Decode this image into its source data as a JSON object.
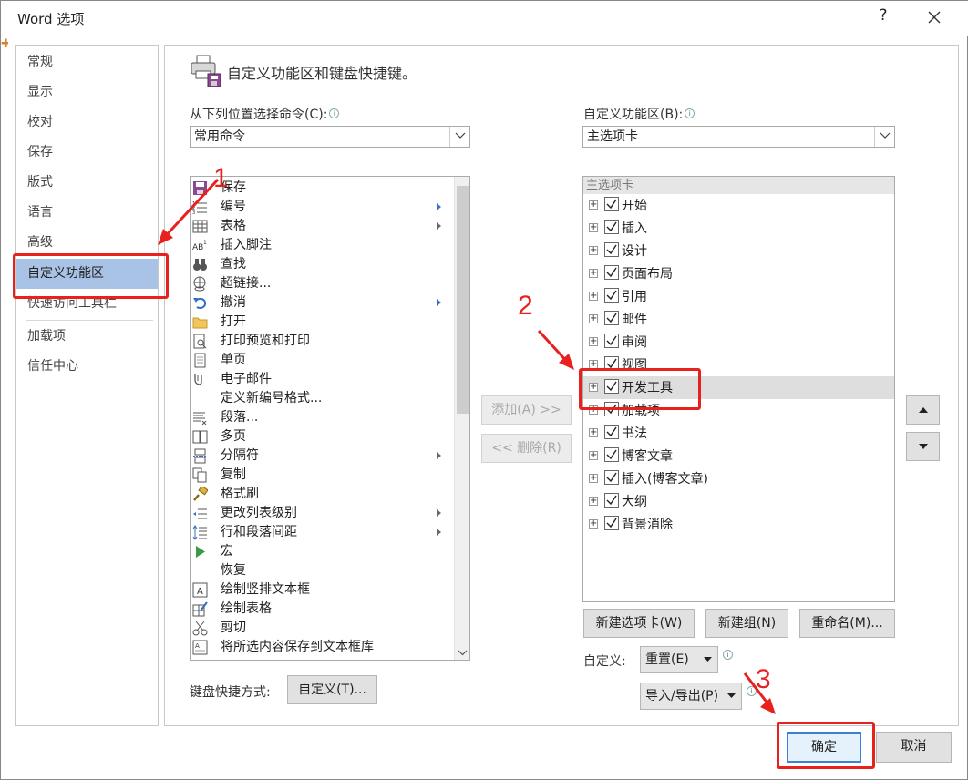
{
  "window": {
    "title": "Word 选项",
    "help": "?"
  },
  "nav": {
    "items": [
      {
        "label": "常规"
      },
      {
        "label": "显示"
      },
      {
        "label": "校对"
      },
      {
        "label": "保存"
      },
      {
        "label": "版式"
      },
      {
        "label": "语言"
      },
      {
        "label": "高级"
      },
      {
        "label": "自定义功能区",
        "selected": true
      },
      {
        "label": "快速访问工具栏"
      },
      {
        "label": "加载项"
      },
      {
        "label": "信任中心"
      }
    ]
  },
  "header": {
    "title": "自定义功能区和键盘快捷键。"
  },
  "left_panel": {
    "choose_label": "从下列位置选择命令(C):",
    "choose_value": "常用命令",
    "commands": [
      {
        "label": "保存",
        "icon": "save-icon"
      },
      {
        "label": "编号",
        "icon": "numbering-icon",
        "submenu": "blue"
      },
      {
        "label": "表格",
        "icon": "table-icon",
        "submenu": "gray"
      },
      {
        "label": "插入脚注",
        "icon": "footnote-icon"
      },
      {
        "label": "查找",
        "icon": "binoculars-icon"
      },
      {
        "label": "超链接...",
        "icon": "hyperlink-icon"
      },
      {
        "label": "撤消",
        "icon": "undo-icon",
        "submenu": "blue"
      },
      {
        "label": "打开",
        "icon": "folder-icon"
      },
      {
        "label": "打印预览和打印",
        "icon": "print-preview-icon"
      },
      {
        "label": "单页",
        "icon": "page-icon"
      },
      {
        "label": "电子邮件",
        "icon": "email-icon"
      },
      {
        "label": "定义新编号格式...",
        "icon": ""
      },
      {
        "label": "段落...",
        "icon": "paragraph-icon"
      },
      {
        "label": "多页",
        "icon": "multipage-icon"
      },
      {
        "label": "分隔符",
        "icon": "break-icon",
        "submenu": "gray"
      },
      {
        "label": "复制",
        "icon": "copy-icon"
      },
      {
        "label": "格式刷",
        "icon": "format-painter-icon"
      },
      {
        "label": "更改列表级别",
        "icon": "list-level-icon",
        "submenu": "gray"
      },
      {
        "label": "行和段落间距",
        "icon": "line-spacing-icon",
        "submenu": "gray"
      },
      {
        "label": "宏",
        "icon": "macro-icon"
      },
      {
        "label": "恢复",
        "icon": ""
      },
      {
        "label": "绘制竖排文本框",
        "icon": "vertical-textbox-icon"
      },
      {
        "label": "绘制表格",
        "icon": "draw-table-icon"
      },
      {
        "label": "剪切",
        "icon": "scissors-icon"
      },
      {
        "label": "将所选内容保存到文本框库",
        "icon": "textbox-gallery-icon"
      }
    ],
    "shortcut_label": "键盘快捷方式:",
    "shortcut_button": "自定义(T)..."
  },
  "middle": {
    "add_button": "添加(A) >>",
    "remove_button": "<< 删除(R)"
  },
  "right_panel": {
    "ribbon_label": "自定义功能区(B):",
    "ribbon_value": "主选项卡",
    "tree_header": "主选项卡",
    "tabs": [
      {
        "label": "开始",
        "checked": true
      },
      {
        "label": "插入",
        "checked": true
      },
      {
        "label": "设计",
        "checked": true
      },
      {
        "label": "页面布局",
        "checked": true
      },
      {
        "label": "引用",
        "checked": true
      },
      {
        "label": "邮件",
        "checked": true
      },
      {
        "label": "审阅",
        "checked": true
      },
      {
        "label": "视图",
        "checked": true
      },
      {
        "label": "开发工具",
        "checked": true,
        "highlighted": true
      },
      {
        "label": "加载项",
        "checked": true
      },
      {
        "label": "书法",
        "checked": true
      },
      {
        "label": "博客文章",
        "checked": true
      },
      {
        "label": "插入(博客文章)",
        "checked": true
      },
      {
        "label": "大纲",
        "checked": true
      },
      {
        "label": "背景消除",
        "checked": true
      }
    ],
    "new_tab_button": "新建选项卡(W)",
    "new_group_button": "新建组(N)",
    "rename_button": "重命名(M)...",
    "customize_label": "自定义:",
    "reset_button": "重置(E)",
    "import_export_button": "导入/导出(P)"
  },
  "footer": {
    "ok_button": "确定",
    "cancel_button": "取消"
  },
  "annotations": {
    "step1": "1",
    "step2": "2",
    "step3": "3",
    "color": "#e8211f"
  }
}
